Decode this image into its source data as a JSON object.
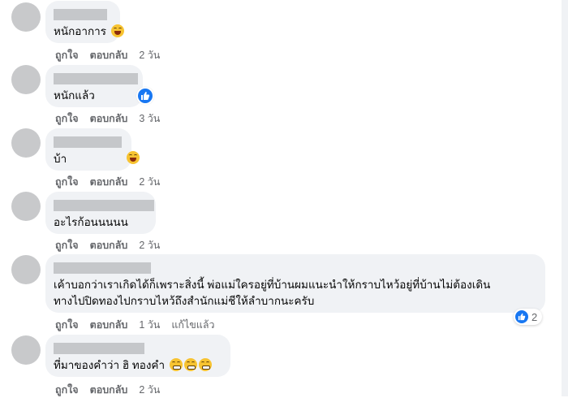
{
  "actions": {
    "like": "ถูกใจ",
    "reply": "ตอบกลับ",
    "edited": "แก้ไขแล้ว"
  },
  "comments": [
    {
      "text": "หนักอาการ",
      "time": "2 วัน",
      "reaction": "laugh"
    },
    {
      "text": "หนักแล้ว",
      "time": "3 วัน",
      "reaction": "like"
    },
    {
      "text": "บ้า",
      "time": "2 วัน",
      "reaction": "laugh"
    },
    {
      "text": "อะไรก้อนนนนน",
      "time": "2 วัน",
      "reaction": "none"
    },
    {
      "text_line1": "เค้าบอกว่าเราเกิดได้ก็เพราะสิ่งนี้ พ่อแม่ใครอยู่ที่บ้านผมแนะนำให้กราบไหว้อยู่ที่บ้านไม่ต้องเดิน",
      "text_line2": "ทางไปปิดทองไปกราบไหว้ถึงสำนักแม่ชีให้ลำบากนะครับ",
      "time": "1 วัน",
      "reaction_count": "2",
      "edited": true
    },
    {
      "text": "ที่มาของคำว่า ฮิ ทองคำ",
      "time": "2 วัน",
      "reaction": "grin"
    }
  ],
  "colors": {
    "bubble": "#f0f2f5",
    "like_blue": "#1877f2",
    "meta": "#65676b"
  }
}
